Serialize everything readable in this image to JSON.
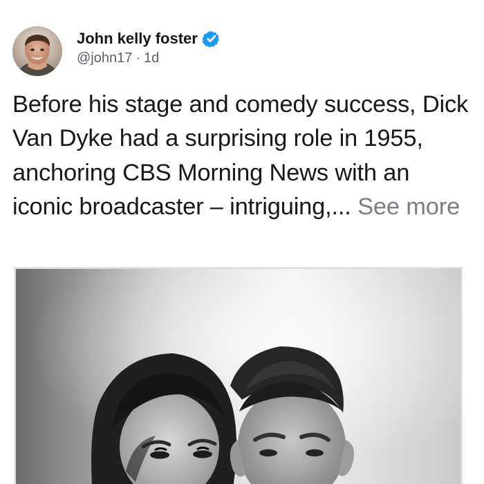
{
  "author": {
    "name": "John kelly foster",
    "handle": "@john17",
    "separator": "·",
    "timestamp": "1d",
    "verified_color": "#1d9bf0"
  },
  "post": {
    "text": "Before his stage and comedy success, Dick Van Dyke had a surprising role in 1955, anchoring CBS Morning News with an iconic broadcaster – intriguing,... ",
    "see_more": "See more"
  },
  "icons": {
    "avatar": "profile-photo",
    "verified": "verified-check-icon",
    "media": "black-and-white-portrait-photo"
  }
}
